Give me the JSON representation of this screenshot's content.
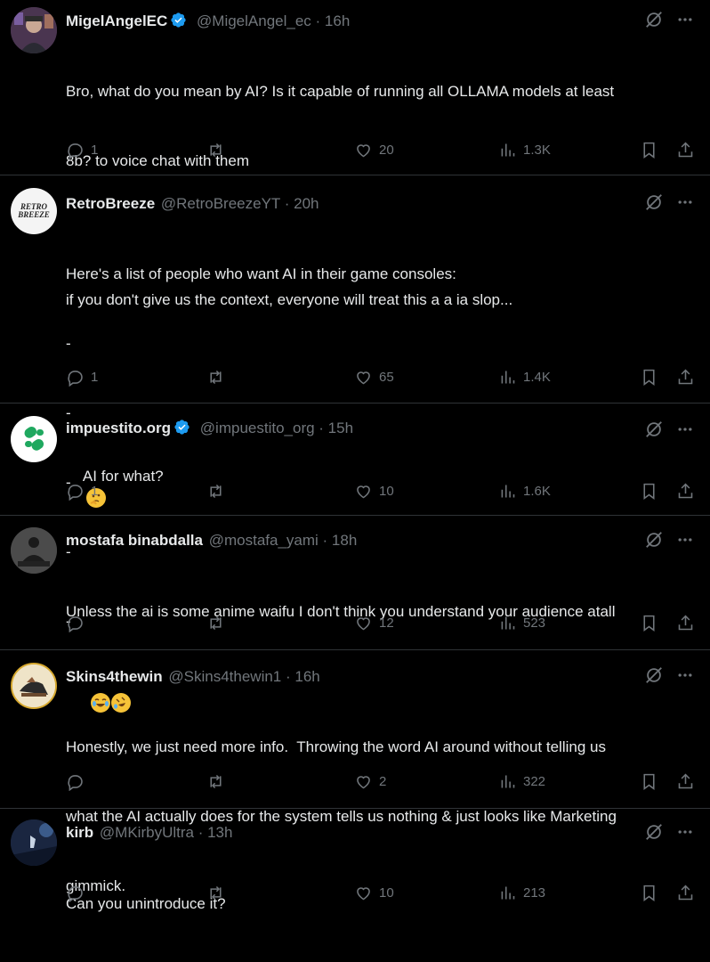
{
  "tweets": [
    {
      "name": "MigelAngelEC",
      "verified": true,
      "handle": "@MigelAngel_ec",
      "time": "· 16h",
      "lines": [
        "Bro, what do you mean by AI? Is it capable of running all OLLAMA models at least",
        "8b? to voice chat with them",
        "",
        "if you don't give us the context, everyone will treat this a a ia slop..."
      ],
      "replies": "1",
      "likes": "20",
      "views": "1.3K",
      "reposts": ""
    },
    {
      "name": "RetroBreeze",
      "verified": false,
      "handle": "@RetroBreezeYT",
      "time": "· 20h",
      "lines": [
        "Here's a list of people who want AI in their game consoles:",
        "-",
        "-",
        "-",
        "-",
        "-"
      ],
      "replies": "1",
      "likes": "65",
      "views": "1.4K",
      "reposts": "",
      "avatar_text": "RETRO BREEZE"
    },
    {
      "name": "impuestito.org",
      "verified": true,
      "handle": "@impuestito_org",
      "time": "· 15h",
      "lines": [
        "AI for what?"
      ],
      "emoji_after": "thinking-face",
      "replies": "1",
      "likes": "10",
      "views": "1.6K",
      "reposts": ""
    },
    {
      "name": "mostafa binabdalla",
      "verified": false,
      "handle": "@mostafa_yami",
      "time": "· 18h",
      "lines": [
        "Unless the ai is some anime waifu I don't think you understand your audience atall"
      ],
      "emoji_line": [
        "face-with-tears-of-joy",
        "rolling-on-floor-laughing"
      ],
      "replies": "",
      "likes": "12",
      "views": "523",
      "reposts": ""
    },
    {
      "name": "Skins4thewin",
      "verified": false,
      "handle": "@Skins4thewin1",
      "time": "· 16h",
      "lines": [
        "Honestly, we just need more info.  Throwing the word AI around without telling us",
        "what the AI actually does for the system tells us nothing & just looks like Marketing",
        "gimmick."
      ],
      "replies": "",
      "likes": "2",
      "views": "322",
      "reposts": ""
    },
    {
      "name": "kirb",
      "verified": false,
      "handle": "@MKirbyUltra",
      "time": "· 13h",
      "lines": [
        "Can you unintroduce it?"
      ],
      "replies": "",
      "likes": "10",
      "views": "213",
      "reposts": ""
    }
  ],
  "colors": {
    "background": "#000000",
    "text": "#e7e9ea",
    "muted": "#71767b",
    "divider": "#2f3336",
    "verified": "#1d9bf0"
  },
  "icons": [
    "grok-icon",
    "more-icon",
    "reply-icon",
    "repost-icon",
    "like-icon",
    "views-icon",
    "bookmark-icon",
    "share-icon"
  ]
}
